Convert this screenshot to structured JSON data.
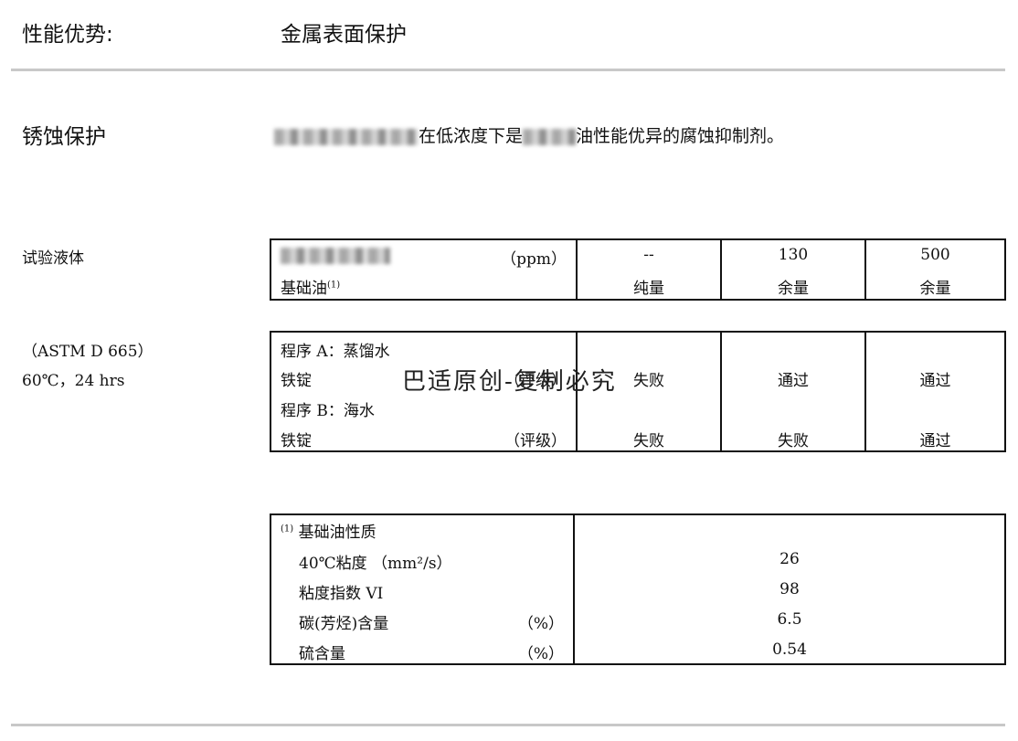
{
  "header": {
    "label": "性能优势:",
    "value": "金属表面保护"
  },
  "section": {
    "title": "锈蚀保护",
    "description_after": "在低浓度下是",
    "description_tail": "油性能优异的腐蚀抑制剂。"
  },
  "side_labels": {
    "test_fluid": "试验液体",
    "method": "（ASTM D 665）",
    "conditions": "60℃，24 hrs"
  },
  "table1": {
    "row1_unit": "（ppm）",
    "row2_label": "基础油",
    "row2_sup": "(1)",
    "columns": [
      {
        "top": "--",
        "bottom": "纯量"
      },
      {
        "top": "130",
        "bottom": "余量"
      },
      {
        "top": "500",
        "bottom": "余量"
      }
    ]
  },
  "table2": {
    "proc_a": "程序 A：蒸馏水",
    "rust_a": "铁锭",
    "proc_b": "程序 B：海水",
    "rust_b": "铁锭",
    "rating_unit": "（评级）",
    "results_a": [
      "失败",
      "通过",
      "通过"
    ],
    "results_b": [
      "失败",
      "失败",
      "通过"
    ]
  },
  "table3": {
    "title_sup": "(1)",
    "title": "基础油性质",
    "rows": [
      {
        "label": "40℃粘度 （mm²/s）",
        "unit": "",
        "value": "26"
      },
      {
        "label": "粘度指数 VI",
        "unit": "",
        "value": "98"
      },
      {
        "label": "碳(芳烃)含量",
        "unit": "（%）",
        "value": "6.5"
      },
      {
        "label": "硫含量",
        "unit": "（%）",
        "value": "0.54"
      }
    ]
  },
  "watermark": "巴适原创-复制必究"
}
